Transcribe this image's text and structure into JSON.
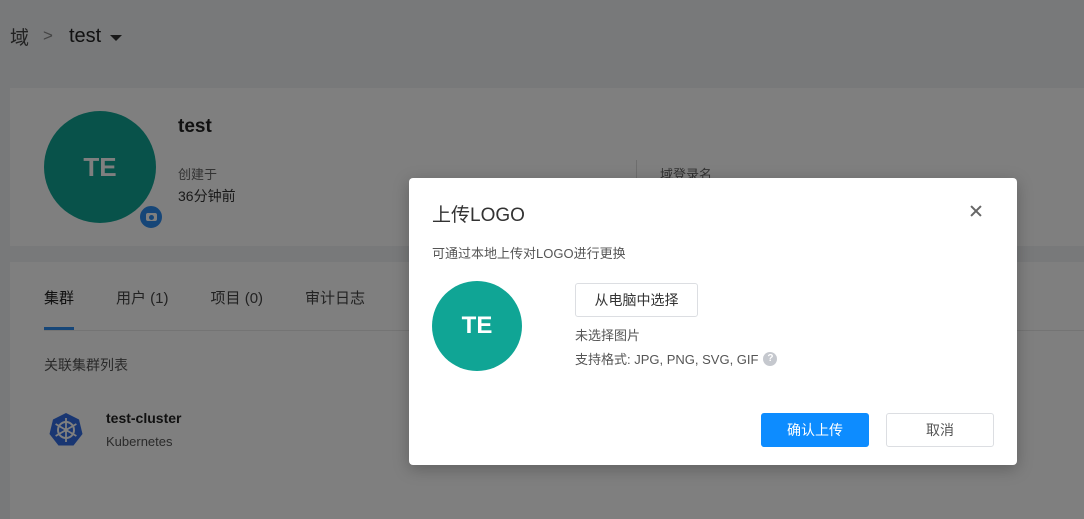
{
  "breadcrumb": {
    "root": "域",
    "separator": ">",
    "current": "test"
  },
  "domain": {
    "name": "test",
    "avatar_initials": "TE",
    "created_label": "创建于",
    "created_value": "36分钟前",
    "login_name_label": "域登录名"
  },
  "tabs": [
    {
      "label": "集群",
      "active": true
    },
    {
      "label": "用户 (1)",
      "active": false
    },
    {
      "label": "项目 (0)",
      "active": false
    },
    {
      "label": "审计日志",
      "active": false
    }
  ],
  "section_title": "关联集群列表",
  "cluster": {
    "name": "test-cluster",
    "type": "Kubernetes"
  },
  "modal": {
    "title": "上传LOGO",
    "description": "可通过本地上传对LOGO进行更换",
    "avatar_initials": "TE",
    "choose_button": "从电脑中选择",
    "no_file": "未选择图片",
    "formats": "支持格式: JPG, PNG, SVG, GIF",
    "help_glyph": "?",
    "confirm_button": "确认上传",
    "cancel_button": "取消"
  },
  "colors": {
    "primary": "#0d8cff",
    "avatar": "#10a595",
    "tab_active": "#2d8cf0"
  }
}
